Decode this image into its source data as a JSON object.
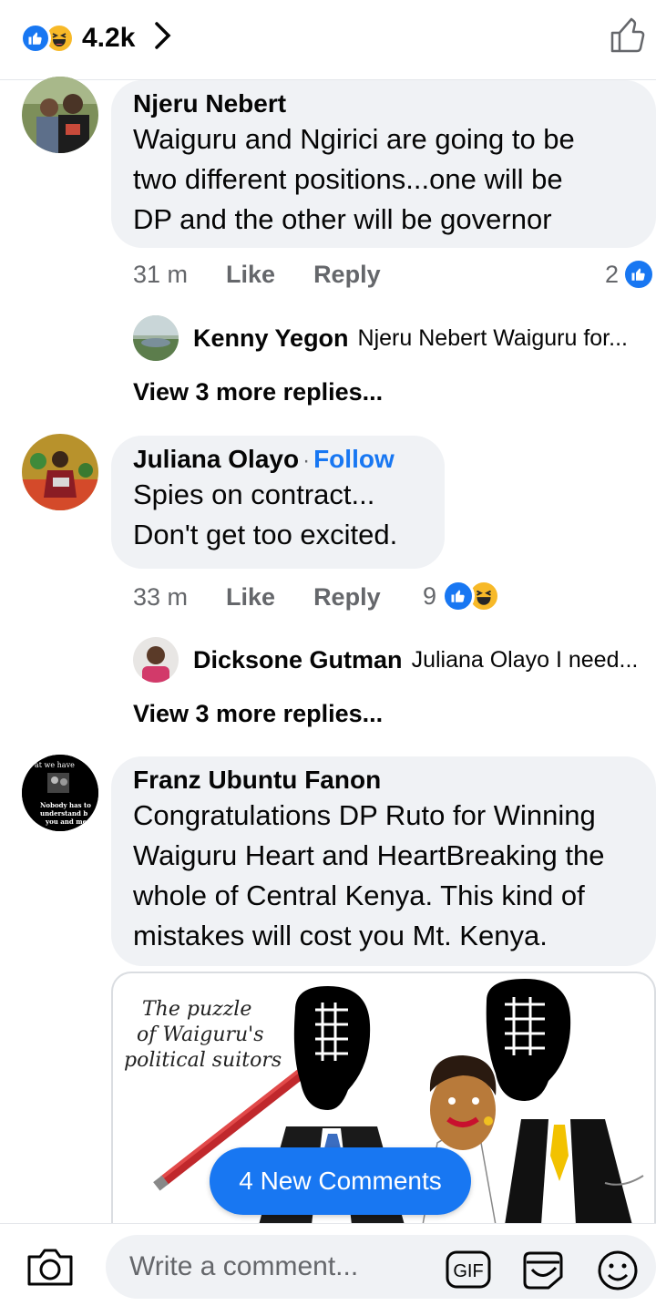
{
  "top_bar": {
    "reaction_count": "4.2k",
    "icons": [
      "like-reaction-icon",
      "haha-reaction-icon",
      "chevron-right-icon",
      "thumbs-up-outline-icon"
    ]
  },
  "comments": [
    {
      "name": "Njeru Nebert",
      "lines": [
        "Waiguru and Ngirici are going to be",
        "two different positions...one will be",
        "DP and the other will be governor"
      ],
      "time": "31 m",
      "like": "Like",
      "reply": "Reply",
      "reaction_count": "2",
      "reply_preview": {
        "name": "Kenny Yegon",
        "text": "Njeru Nebert Waiguru for..."
      },
      "more_replies": "View 3 more replies..."
    },
    {
      "name": "Juliana Olayo",
      "follow_sep": "·",
      "follow": "Follow",
      "lines": [
        "Spies on contract...",
        "Don't get too excited."
      ],
      "time": "33 m",
      "like": "Like",
      "reply": "Reply",
      "reaction_count": "9",
      "reply_preview": {
        "name": "Dicksone Gutman",
        "text": "Juliana Olayo I need..."
      },
      "more_replies": "View 3 more replies..."
    },
    {
      "name": "Franz Ubuntu Fanon",
      "avatar_text": [
        "at we have",
        "Nobody has to",
        "understand b",
        "you and me"
      ],
      "lines": [
        "Congratulations DP Ruto for Winning",
        "Waiguru Heart and HeartBreaking the",
        "whole of Central Kenya. This kind of",
        "mistakes will cost you Mt. Kenya."
      ],
      "image_caption": [
        "The puzzle",
        "of Waiguru's",
        "political suitors"
      ]
    }
  ],
  "new_comments_button": "4 New Comments",
  "composer": {
    "placeholder": "Write a comment...",
    "gif_label": "GIF"
  },
  "colors": {
    "accent": "#1877f2",
    "bubble": "#f0f2f5",
    "secondary_text": "#65676b",
    "haha": "#f7b928"
  }
}
